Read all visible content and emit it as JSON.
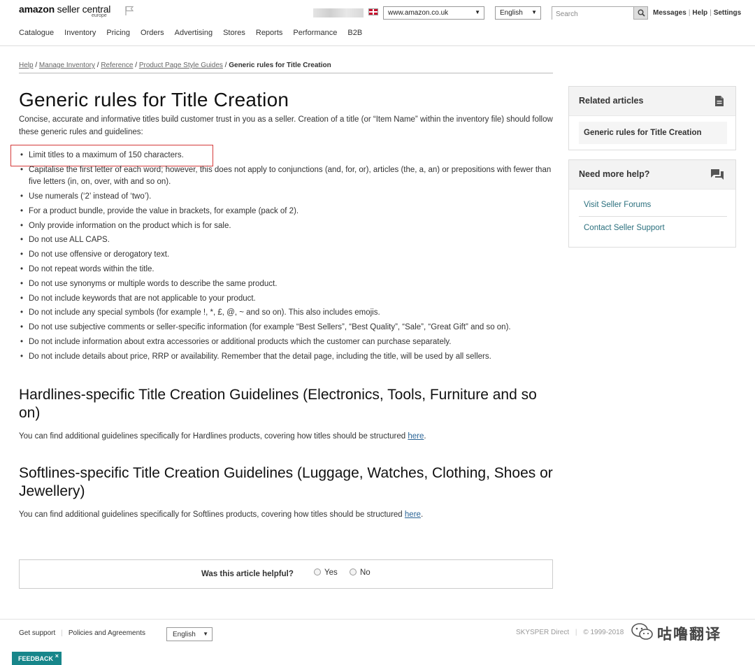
{
  "header": {
    "brand": "amazon",
    "brand_sub": "seller central",
    "region": "europe",
    "site": "www.amazon.co.uk",
    "language": "English",
    "search_placeholder": "Search",
    "utils": [
      "Messages",
      "Help",
      "Settings"
    ]
  },
  "nav": [
    "Catalogue",
    "Inventory",
    "Pricing",
    "Orders",
    "Advertising",
    "Stores",
    "Reports",
    "Performance",
    "B2B"
  ],
  "breadcrumb": {
    "links": [
      "Help",
      "Manage Inventory",
      "Reference",
      "Product Page Style Guides"
    ],
    "current": "Generic rules for Title Creation"
  },
  "article": {
    "title": "Generic rules for Title Creation",
    "intro": "Concise, accurate and informative titles build customer trust in you as a seller. Creation of a title (or “Item Name” within the inventory file) should follow these generic rules and guidelines:",
    "rules": [
      "Limit titles to a maximum of 150 characters.",
      "Capitalise the first letter of each word; however, this does not apply to conjunctions (and, for, or), articles (the, a, an) or prepositions with fewer than five letters (in, on, over, with and so on).",
      "Use numerals (‘2’ instead of ‘two’).",
      "For a product bundle, provide the value in brackets, for example (pack of 2).",
      "Only provide information on the product which is for sale.",
      "Do not use ALL CAPS.",
      "Do not use offensive or derogatory text.",
      "Do not repeat words within the title.",
      "Do not use synonyms or multiple words to describe the same product.",
      "Do not include keywords that are not applicable to your product.",
      "Do not include any special symbols (for example !, *, £, @, ~ and so on). This also includes emojis.",
      "Do not use subjective comments or seller-specific information (for example “Best Sellers”, “Best Quality”, “Sale”, “Great Gift” and so on).",
      "Do not include information about extra accessories or additional products which the customer can purchase separately.",
      "Do not include details about price, RRP or availability. Remember that the detail page, including the title, will be used by all sellers."
    ],
    "hardlines": {
      "heading": "Hardlines-specific Title Creation Guidelines (Electronics, Tools, Furniture and so on)",
      "text": "You can find additional guidelines specifically for Hardlines products, covering how titles should be structured ",
      "link": "here",
      "end": "."
    },
    "softlines": {
      "heading": "Softlines-specific Title Creation Guidelines (Luggage, Watches, Clothing, Shoes or Jewellery)",
      "text": "You can find additional guidelines specifically for Softlines products, covering how titles should be structured ",
      "link": "here",
      "end": "."
    },
    "helpful": {
      "question": "Was this article helpful?",
      "yes": "Yes",
      "no": "No"
    }
  },
  "sidebar": {
    "related_title": "Related articles",
    "related_items": [
      "Generic rules for Title Creation"
    ],
    "help_title": "Need more help?",
    "help_links": [
      "Visit Seller Forums",
      "Contact Seller Support"
    ]
  },
  "footer": {
    "links": [
      "Get support",
      "Policies and Agreements"
    ],
    "language": "English",
    "company": "SKYSPER Direct",
    "copyright": "© 1999-2018",
    "watermark": "咕噜翻译",
    "feedback": "FEEDBACK",
    "feedback_close": "×"
  },
  "colors": {
    "link_blue": "#2a6496",
    "help_link": "#2a6f7d",
    "highlight_red": "#d43a3a",
    "feedback_teal": "#17868a"
  }
}
